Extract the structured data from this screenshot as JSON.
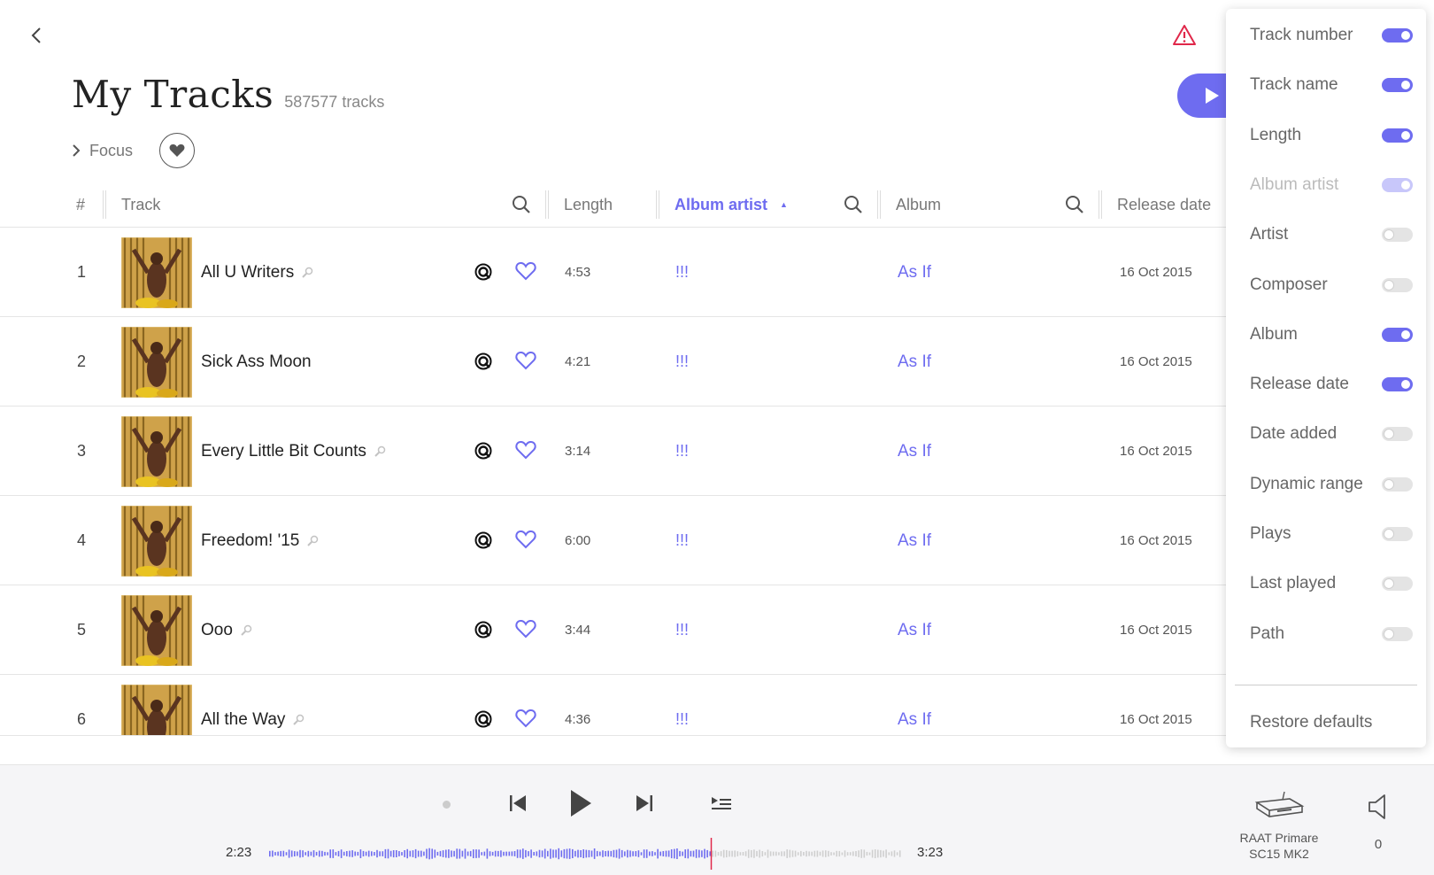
{
  "header": {
    "title": "My Tracks",
    "count": "587577 tracks",
    "focus_label": "Focus"
  },
  "columns": {
    "num": "#",
    "track": "Track",
    "length": "Length",
    "album_artist": "Album artist",
    "album": "Album",
    "release_date": "Release date"
  },
  "tracks": [
    {
      "num": "1",
      "name": "All U Writers",
      "length": "4:53",
      "artist": "!!!",
      "album": "As If",
      "date": "16 Oct 2015"
    },
    {
      "num": "2",
      "name": "Sick Ass Moon",
      "length": "4:21",
      "artist": "!!!",
      "album": "As If",
      "date": "16 Oct 2015"
    },
    {
      "num": "3",
      "name": "Every Little Bit Counts",
      "length": "3:14",
      "artist": "!!!",
      "album": "As If",
      "date": "16 Oct 2015"
    },
    {
      "num": "4",
      "name": "Freedom! '15",
      "length": "6:00",
      "artist": "!!!",
      "album": "As If",
      "date": "16 Oct 2015"
    },
    {
      "num": "5",
      "name": "Ooo",
      "length": "3:44",
      "artist": "!!!",
      "album": "As If",
      "date": "16 Oct 2015"
    },
    {
      "num": "6",
      "name": "All the Way",
      "length": "4:36",
      "artist": "!!!",
      "album": "As If",
      "date": "16 Oct 2015"
    }
  ],
  "column_panel": {
    "items": [
      {
        "label": "Track number",
        "state": "on"
      },
      {
        "label": "Track name",
        "state": "on"
      },
      {
        "label": "Length",
        "state": "on"
      },
      {
        "label": "Album artist",
        "state": "on-disabled"
      },
      {
        "label": "Artist",
        "state": "off"
      },
      {
        "label": "Composer",
        "state": "off"
      },
      {
        "label": "Album",
        "state": "on"
      },
      {
        "label": "Release date",
        "state": "on"
      },
      {
        "label": "Date added",
        "state": "off"
      },
      {
        "label": "Dynamic range",
        "state": "off"
      },
      {
        "label": "Plays",
        "state": "off"
      },
      {
        "label": "Last played",
        "state": "off"
      },
      {
        "label": "Path",
        "state": "off"
      }
    ],
    "restore_label": "Restore defaults"
  },
  "player": {
    "current_time": "2:23",
    "total_time": "3:23",
    "progress": 0.7,
    "zone_line1": "RAAT Primare",
    "zone_line2": "SC15 MK2",
    "volume": "0"
  },
  "colors": {
    "accent": "#6e6cf0",
    "warning": "#e0284a"
  }
}
